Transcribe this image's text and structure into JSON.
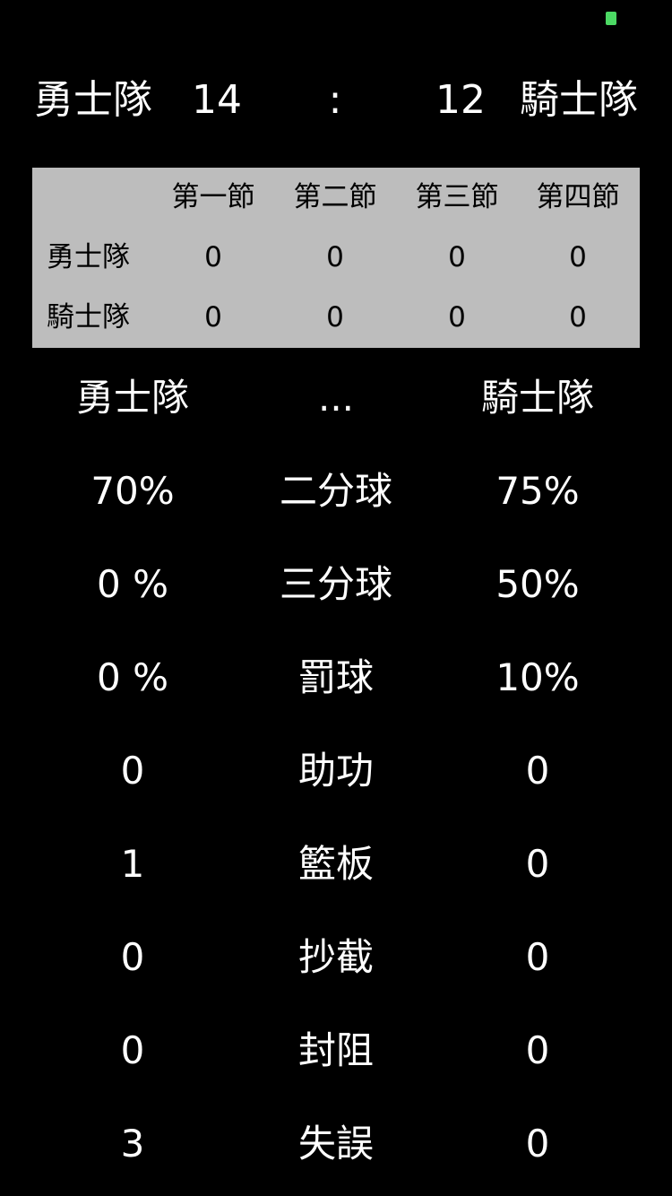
{
  "status": {
    "indicator_color": "#4cd964"
  },
  "scoreboard": {
    "home_team": "勇士隊",
    "home_score": "14",
    "separator": ":",
    "away_score": "12",
    "away_team": "騎士隊"
  },
  "quarters": {
    "headers": [
      "第一節",
      "第二節",
      "第三節",
      "第四節"
    ],
    "rows": [
      {
        "team": "勇士隊",
        "scores": [
          "0",
          "0",
          "0",
          "0"
        ]
      },
      {
        "team": "騎士隊",
        "scores": [
          "0",
          "0",
          "0",
          "0"
        ]
      }
    ]
  },
  "stats": {
    "header": {
      "left": "勇士隊",
      "middle": "...",
      "right": "騎士隊"
    },
    "rows": [
      {
        "left": "70%",
        "label": "二分球",
        "right": "75%"
      },
      {
        "left": "0 %",
        "label": "三分球",
        "right": "50%"
      },
      {
        "left": "0 %",
        "label": "罰球",
        "right": "10%"
      },
      {
        "left": "0",
        "label": "助功",
        "right": "0"
      },
      {
        "left": "1",
        "label": "籃板",
        "right": "0"
      },
      {
        "left": "0",
        "label": "抄截",
        "right": "0"
      },
      {
        "left": "0",
        "label": "封阻",
        "right": "0"
      },
      {
        "left": "3",
        "label": "失誤",
        "right": "0"
      }
    ]
  }
}
